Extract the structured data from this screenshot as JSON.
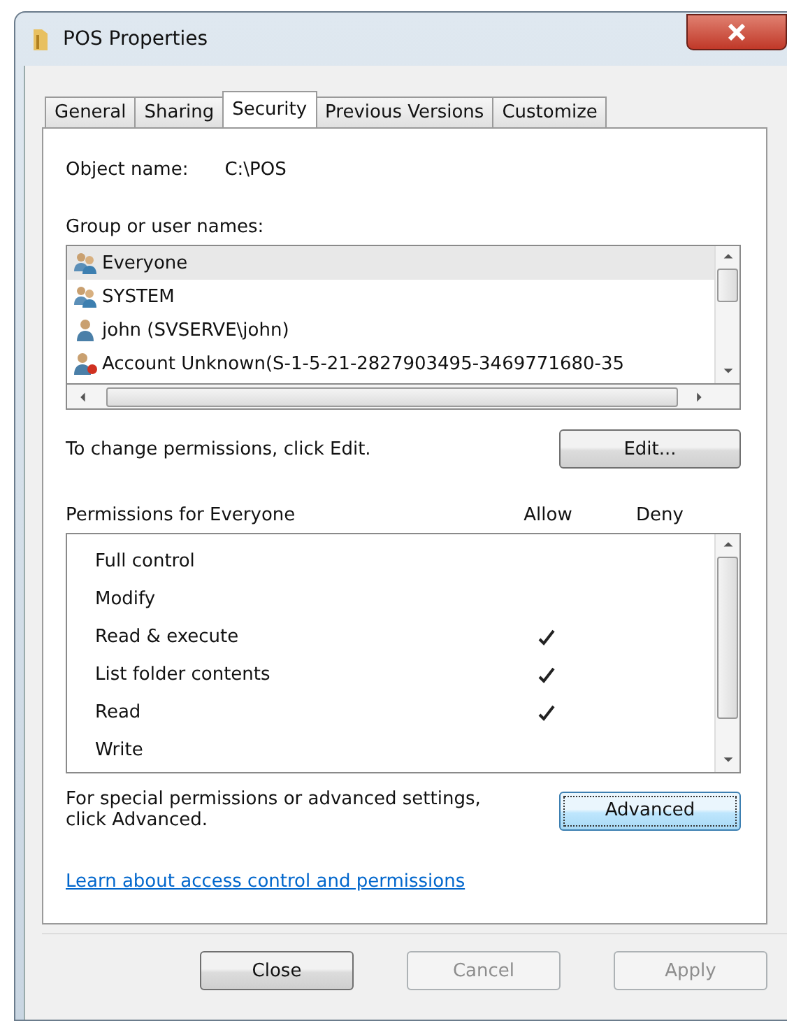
{
  "window": {
    "title": "POS Properties"
  },
  "tabs": [
    {
      "label": "General",
      "selected": false
    },
    {
      "label": "Sharing",
      "selected": false
    },
    {
      "label": "Security",
      "selected": true
    },
    {
      "label": "Previous Versions",
      "selected": false
    },
    {
      "label": "Customize",
      "selected": false
    }
  ],
  "object_name": {
    "label": "Object name:",
    "value": "C:\\POS"
  },
  "groups": {
    "label": "Group or user names:",
    "items": [
      {
        "name": "Everyone",
        "kind": "group",
        "selected": true
      },
      {
        "name": "SYSTEM",
        "kind": "group",
        "selected": false
      },
      {
        "name": "john (SVSERVE\\john)",
        "kind": "user",
        "selected": false
      },
      {
        "name": "Account Unknown(S-1-5-21-2827903495-3469771680-35",
        "kind": "unknown",
        "selected": false
      }
    ]
  },
  "change_hint": "To change permissions, click Edit.",
  "edit_button": "Edit...",
  "permissions": {
    "label": "Permissions for Everyone",
    "columns": [
      "Allow",
      "Deny"
    ],
    "rows": [
      {
        "name": "Full control",
        "allow": false,
        "deny": false
      },
      {
        "name": "Modify",
        "allow": false,
        "deny": false
      },
      {
        "name": "Read & execute",
        "allow": true,
        "deny": false
      },
      {
        "name": "List folder contents",
        "allow": true,
        "deny": false
      },
      {
        "name": "Read",
        "allow": true,
        "deny": false
      },
      {
        "name": "Write",
        "allow": false,
        "deny": false
      }
    ]
  },
  "advanced_hint": "For special permissions or advanced settings, click Advanced.",
  "advanced_button": "Advanced",
  "learn_link": "Learn about access control and permissions",
  "buttons": [
    {
      "label": "Close",
      "disabled": false
    },
    {
      "label": "Cancel",
      "disabled": true
    },
    {
      "label": "Apply",
      "disabled": true
    }
  ]
}
